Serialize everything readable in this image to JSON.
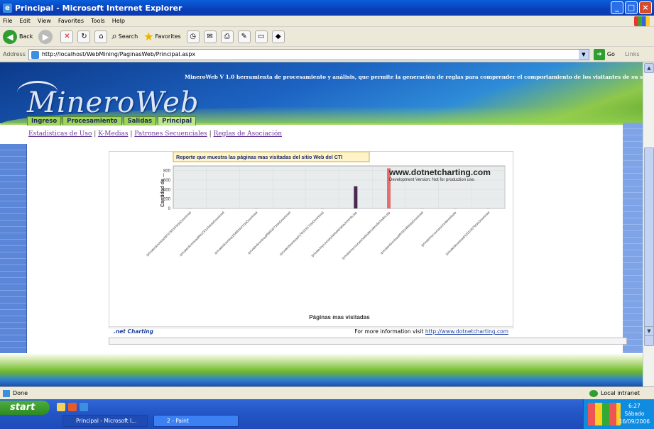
{
  "window": {
    "title": "Principal - Microsoft Internet Explorer"
  },
  "menu": [
    "File",
    "Edit",
    "View",
    "Favorites",
    "Tools",
    "Help"
  ],
  "toolbar": {
    "back_label": "Back",
    "search_label": "Search",
    "favorites_label": "Favorites"
  },
  "address": {
    "label": "Address",
    "url": "http://localhost/WebMining/PaginasWeb/Principal.aspx",
    "go_label": "Go",
    "links_label": "Links"
  },
  "page": {
    "tagline": "MineroWeb V 1.0 herramienta de procesamiento y análisis, que permite la generación de reglas para comprender el comportamiento de los visitantes de su sitio web.",
    "logo_text": "MineroWeb",
    "tabs": [
      "Ingreso",
      "Procesamiento",
      "Salidas",
      "Principal"
    ],
    "sublinks": [
      "Estadisticas de Uso",
      "K-Medias",
      "Patrones Secuenciales",
      "Reglas de Asociación"
    ],
    "sublink_separator": "|"
  },
  "chart_footer": {
    "brand": ".net Charting",
    "more_text": "For more information visit",
    "more_link": "http://www.dotnetcharting.com"
  },
  "status": {
    "left": "Done",
    "zone": "Local intranet"
  },
  "taskbar": {
    "start_label": "start",
    "tasks": [
      "Principal - Microsoft I...",
      "2 - Paint"
    ],
    "clock": {
      "time": "6:27",
      "day": "Sábado",
      "date": "16/09/2006"
    }
  },
  "colors": {
    "bar_dark": "#4a2850",
    "bar_highlight": "#e26f6f",
    "plot_bg": "#e8ecec"
  },
  "chart_data": {
    "type": "bar",
    "title": "Reporte que muestra las páginas mas visitadas del sitio Web del CTI",
    "watermark": "www.dotnetcharting.com",
    "watermark_sub": "Development Version: Not for production use.",
    "xlabel": "Páginas mas visitadas",
    "ylabel": "Cantidad de ...",
    "ylim": [
      0,
      900
    ],
    "yticks": [
      0,
      200,
      400,
      600,
      800
    ],
    "grid": true,
    "categories": [
      "/private/download/972/3/1543/doDownload",
      "/private/download/942/3/1334/doDownload",
      "/private/download/348/1847/doDownload",
      "/private/download/999/3073/doDownload",
      "/private/download/1760/1917/doDownload",
      "/private/mycourses/website/attachments.jsp",
      "/private/mycourses/website/calendar/index.jsp",
      "/private/download/978/2489/doDownload",
      "/private/mycourses/createwebsite",
      "/private/download/1011/2676/doDownload"
    ],
    "values": [
      5,
      5,
      5,
      5,
      5,
      470,
      850,
      5,
      5,
      5
    ]
  }
}
